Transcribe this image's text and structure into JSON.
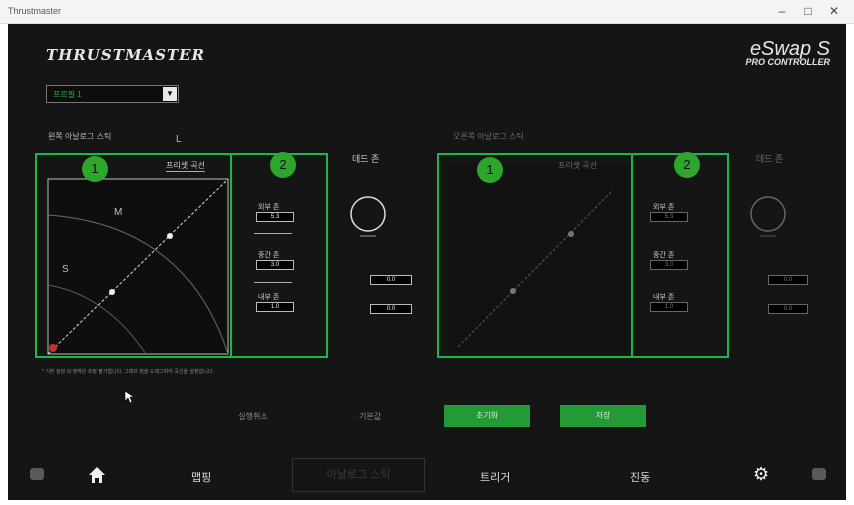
{
  "window": {
    "title": "Thrustmaster",
    "controls": [
      "–",
      "□",
      "✕"
    ]
  },
  "brand": {
    "logo": "THRUSTMASTER",
    "product": "eSwap S",
    "product_sub": "PRO CONTROLLER"
  },
  "profile": {
    "selected": "프로필 1"
  },
  "left_stick": {
    "section_label": "왼쪽 아날로그 스틱",
    "curve_btn": "프리셋 곡선",
    "zone_labels": {
      "l": "L",
      "m": "M",
      "s": "S"
    },
    "dead_zone_label": "데드 존",
    "zones": [
      {
        "label": "외부 존",
        "value": "5.3"
      },
      {
        "label": "중간 존",
        "value": "3.0"
      },
      {
        "label": "내부 존",
        "value": "1.0"
      }
    ],
    "extra_values": [
      "0.0",
      "0.0"
    ]
  },
  "right_stick": {
    "section_label": "오른쪽 아날로그 스틱",
    "curve_btn": "프리셋 곡선",
    "dead_zone_label": "데드 존",
    "zones": [
      {
        "label": "외부 존",
        "value": "5.3"
      },
      {
        "label": "중간 존",
        "value": "3.0"
      },
      {
        "label": "내부 존",
        "value": "1.0"
      }
    ],
    "extra_values": [
      "0.0",
      "0.0"
    ]
  },
  "badges": {
    "one": "1",
    "two": "2"
  },
  "note": "* 기본 설정 외 영역은 조정 불가합니다. 그래프 점을 드래그하여 곡선을 설정합니다.",
  "actions": {
    "cancel": "실행취소",
    "default": "기본값",
    "reset": "초기화",
    "save": "저장"
  },
  "nav": {
    "map": "맵핑",
    "sticks": "아날로그 스틱",
    "triggers": "트리거",
    "vibration": "진동"
  },
  "colors": {
    "accent_green": "#1db746",
    "button_green": "#229a36",
    "background": "#151515"
  }
}
